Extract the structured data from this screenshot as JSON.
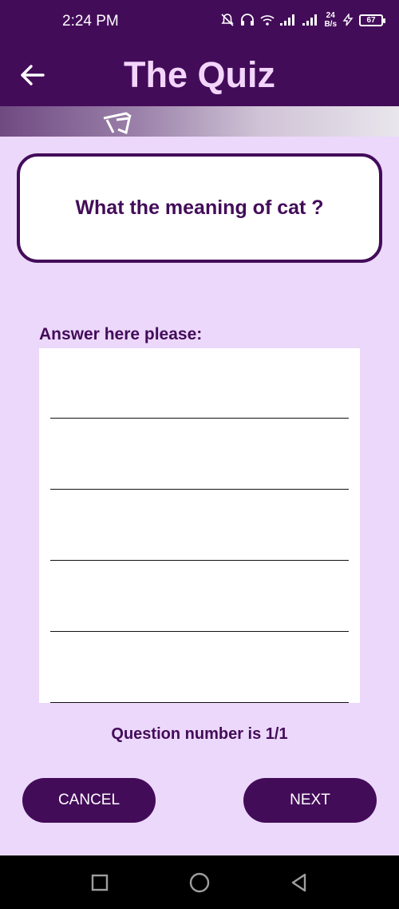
{
  "status_bar": {
    "time": "2:24 PM",
    "net_speed_value": "24",
    "net_speed_unit": "B/s",
    "battery_level": "67"
  },
  "app_bar": {
    "title": "The Quiz"
  },
  "question": {
    "text": "What the meaning of cat ?"
  },
  "answer": {
    "label": "Answer here please:",
    "value": ""
  },
  "progress": {
    "text": "Question number is 1/1"
  },
  "buttons": {
    "cancel_label": "CANCEL",
    "next_label": "NEXT"
  },
  "nav_bar": {
    "items": [
      "recents-square-icon",
      "home-circle-icon",
      "back-triangle-icon"
    ]
  },
  "colors": {
    "primary": "#430c59",
    "background": "#ecd8fb",
    "title_text": "#f3d5fb"
  }
}
